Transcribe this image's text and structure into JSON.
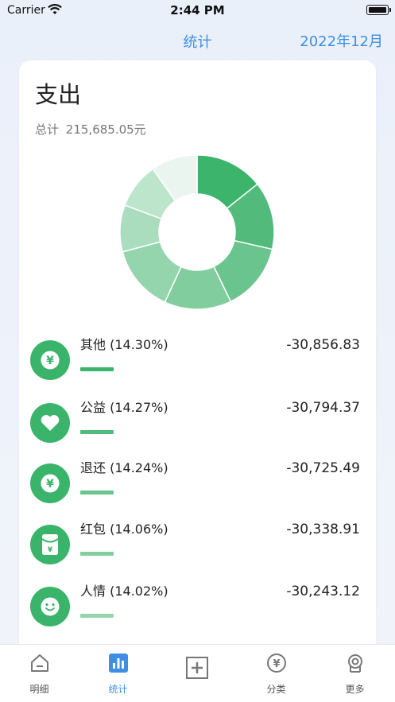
{
  "status_bar": {
    "carrier": "Carrier",
    "time": "2:44 PM"
  },
  "nav": {
    "title": "统计",
    "month": "2022年12月"
  },
  "card": {
    "title": "支出",
    "total_label": "总计",
    "total_value": "215,685.05元"
  },
  "donut_segments": [
    {
      "share": 14.3,
      "color": "#3cb46c"
    },
    {
      "share": 14.27,
      "color": "#52bb7b"
    },
    {
      "share": 14.24,
      "color": "#6ac48d"
    },
    {
      "share": 14.06,
      "color": "#82cd9e"
    },
    {
      "share": 14.02,
      "color": "#95d5ad"
    },
    {
      "share": 9.8,
      "color": "#a9ddbd"
    },
    {
      "share": 9.6,
      "color": "#bde5cc"
    },
    {
      "share": 9.71,
      "color": "#e9f5ee"
    }
  ],
  "rows": [
    {
      "label": "其他 (14.30%)",
      "amount": "-30,856.83",
      "icon": "yen-icon",
      "bar_color": "#3bb46b"
    },
    {
      "label": "公益 (14.27%)",
      "amount": "-30,794.37",
      "icon": "heart-icon",
      "bar_color": "#52bb7b"
    },
    {
      "label": "退还 (14.24%)",
      "amount": "-30,725.49",
      "icon": "yen-icon",
      "bar_color": "#6ac48d"
    },
    {
      "label": "红包 (14.06%)",
      "amount": "-30,338.91",
      "icon": "red-packet-icon",
      "bar_color": "#82cd9e"
    },
    {
      "label": "人情 (14.02%)",
      "amount": "-30,243.12",
      "icon": "smile-icon",
      "bar_color": "#95d5ad"
    }
  ],
  "tabs": [
    {
      "label": "明细",
      "icon": "home-icon",
      "active": false
    },
    {
      "label": "统计",
      "icon": "chart-icon",
      "active": true
    },
    {
      "label": "",
      "icon": "add-icon",
      "active": false
    },
    {
      "label": "分类",
      "icon": "yen-circle-icon",
      "active": false
    },
    {
      "label": "更多",
      "icon": "more-icon",
      "active": false
    }
  ]
}
